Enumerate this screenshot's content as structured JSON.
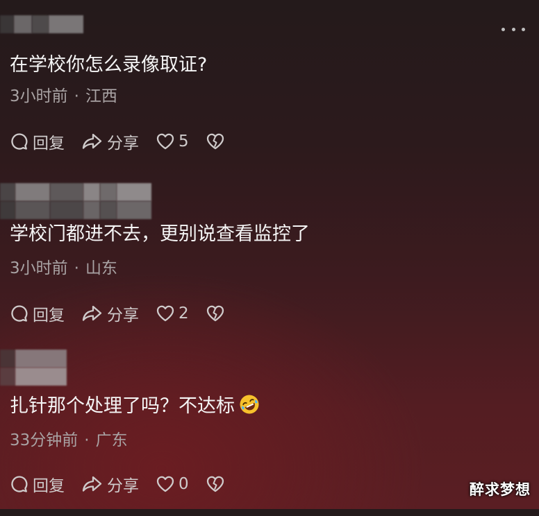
{
  "comments": [
    {
      "text": "在学校你怎么录像取证?",
      "time": "3小时前",
      "separator": "·",
      "location": "江西",
      "reply_label": "回复",
      "share_label": "分享",
      "likes": "5"
    },
    {
      "text": "学校门都进不去，更别说查看监控了",
      "time": "3小时前",
      "separator": "·",
      "location": "山东",
      "reply_label": "回复",
      "share_label": "分享",
      "likes": "2"
    },
    {
      "text": "扎针那个处理了吗？不达标",
      "emoji": "rolling-on-floor-laughing-emoji",
      "time": "33分钟前",
      "separator": "·",
      "location": "广东",
      "reply_label": "回复",
      "share_label": "分享",
      "likes": "0"
    }
  ],
  "icons": {
    "more": "more-dots-icon",
    "reply": "speech-bubble-icon",
    "share": "share-arrow-icon",
    "like": "heart-icon",
    "dislike": "broken-heart-icon"
  },
  "watermark": "醉求梦想",
  "colors": {
    "text_primary": "#f5f5f5",
    "text_meta": "#a9a3a4",
    "action_gray": "#cfcbcb",
    "emoji_yellow": "#f7c12c",
    "background_top": "#241a1b",
    "background_bottom": "#5a1e23"
  }
}
